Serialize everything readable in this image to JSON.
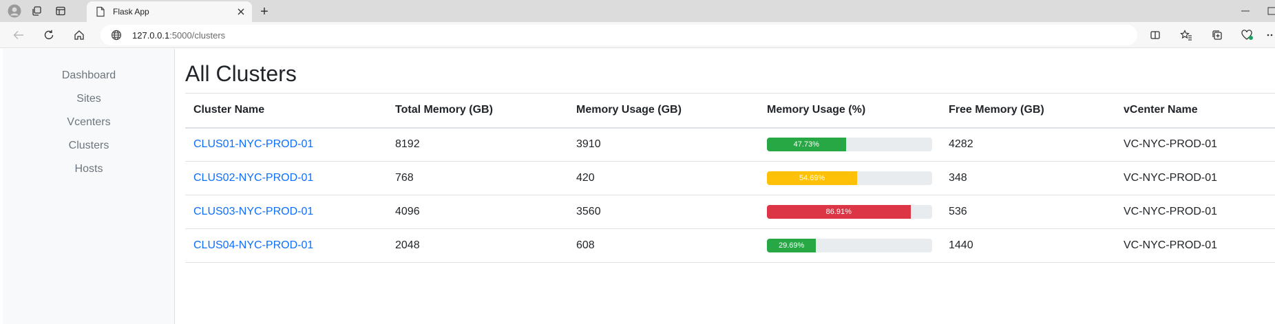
{
  "browser": {
    "tab_title": "Flask App",
    "new_tab_label": "+",
    "url_host": "127.0.0.1",
    "url_path": ":5000/clusters"
  },
  "sidebar": {
    "items": [
      {
        "label": "Dashboard"
      },
      {
        "label": "Sites"
      },
      {
        "label": "Vcenters"
      },
      {
        "label": "Clusters"
      },
      {
        "label": "Hosts"
      }
    ]
  },
  "main": {
    "title": "All Clusters",
    "columns": [
      "Cluster Name",
      "Total Memory (GB)",
      "Memory Usage (GB)",
      "Memory Usage (%)",
      "Free Memory (GB)",
      "vCenter Name"
    ],
    "rows": [
      {
        "name": "CLUS01-NYC-PROD-01",
        "total": "8192",
        "used": "3910",
        "pct": 47.73,
        "pct_label": "47.73%",
        "color": "#28a745",
        "free": "4282",
        "vcenter": "VC-NYC-PROD-01"
      },
      {
        "name": "CLUS02-NYC-PROD-01",
        "total": "768",
        "used": "420",
        "pct": 54.69,
        "pct_label": "54.69%",
        "color": "#ffc107",
        "free": "348",
        "vcenter": "VC-NYC-PROD-01"
      },
      {
        "name": "CLUS03-NYC-PROD-01",
        "total": "4096",
        "used": "3560",
        "pct": 86.91,
        "pct_label": "86.91%",
        "color": "#dc3545",
        "free": "536",
        "vcenter": "VC-NYC-PROD-01"
      },
      {
        "name": "CLUS04-NYC-PROD-01",
        "total": "2048",
        "used": "608",
        "pct": 29.69,
        "pct_label": "29.69%",
        "color": "#28a745",
        "free": "1440",
        "vcenter": "VC-NYC-PROD-01"
      }
    ]
  },
  "colors": {
    "link": "#0d6efd",
    "success": "#28a745",
    "warning": "#ffc107",
    "danger": "#dc3545"
  }
}
